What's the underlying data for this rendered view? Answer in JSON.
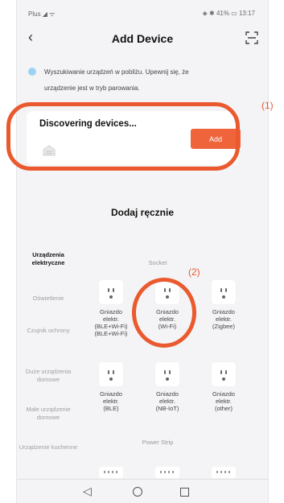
{
  "status_bar": {
    "left": "Plus ◢ ᯤ",
    "right": "◈ ✱ 41% ▭ 13:17"
  },
  "header": {
    "back_label": "‹",
    "title": "Add Device"
  },
  "info": {
    "text_line1": "Wyszukiwanie urządzeń w pobliżu. Upewnij się, że",
    "text_line2": "urządzenie jest w tryb parowania."
  },
  "discover": {
    "title": "Discovering devices...",
    "add_label": "Add"
  },
  "callouts": {
    "label1": "(1)",
    "label2": "(2)"
  },
  "manual": {
    "title": "Dodaj ręcznie"
  },
  "categories": [
    "Urządzenia elektryczne",
    "Oświetlenie",
    "Czujnik ochrony",
    "Duże urządzenia domowe",
    "Małe urządzenie domowe",
    "Urządzenie kuchenne"
  ],
  "sections": {
    "socket": "Socket",
    "power_strip": "Power Strip"
  },
  "devices": [
    {
      "label_line1": "Gniazdo",
      "label_line2": "elektr.",
      "label_line3": "(BLE+Wi-Fi)",
      "label_line4": "(BLE+Wi-Fi)"
    },
    {
      "label_line1": "Gniazdo",
      "label_line2": "elektr.",
      "label_line3": "(Wi-Fi)",
      "label_line4": ""
    },
    {
      "label_line1": "Gniazdo",
      "label_line2": "elektr.",
      "label_line3": "(Zigbee)",
      "label_line4": ""
    },
    {
      "label_line1": "Gniazdo",
      "label_line2": "elektr.",
      "label_line3": "(BLE)",
      "label_line4": ""
    },
    {
      "label_line1": "Gniazdo",
      "label_line2": "elektr.",
      "label_line3": "(NB-IoT)",
      "label_line4": ""
    },
    {
      "label_line1": "Gniazdo",
      "label_line2": "elektr.",
      "label_line3": "(other)",
      "label_line4": ""
    }
  ],
  "nav": {
    "back": "◁"
  },
  "colors": {
    "accent": "#f0643c",
    "callout": "#ea5a2e",
    "info_dot": "#9dd3f2"
  }
}
